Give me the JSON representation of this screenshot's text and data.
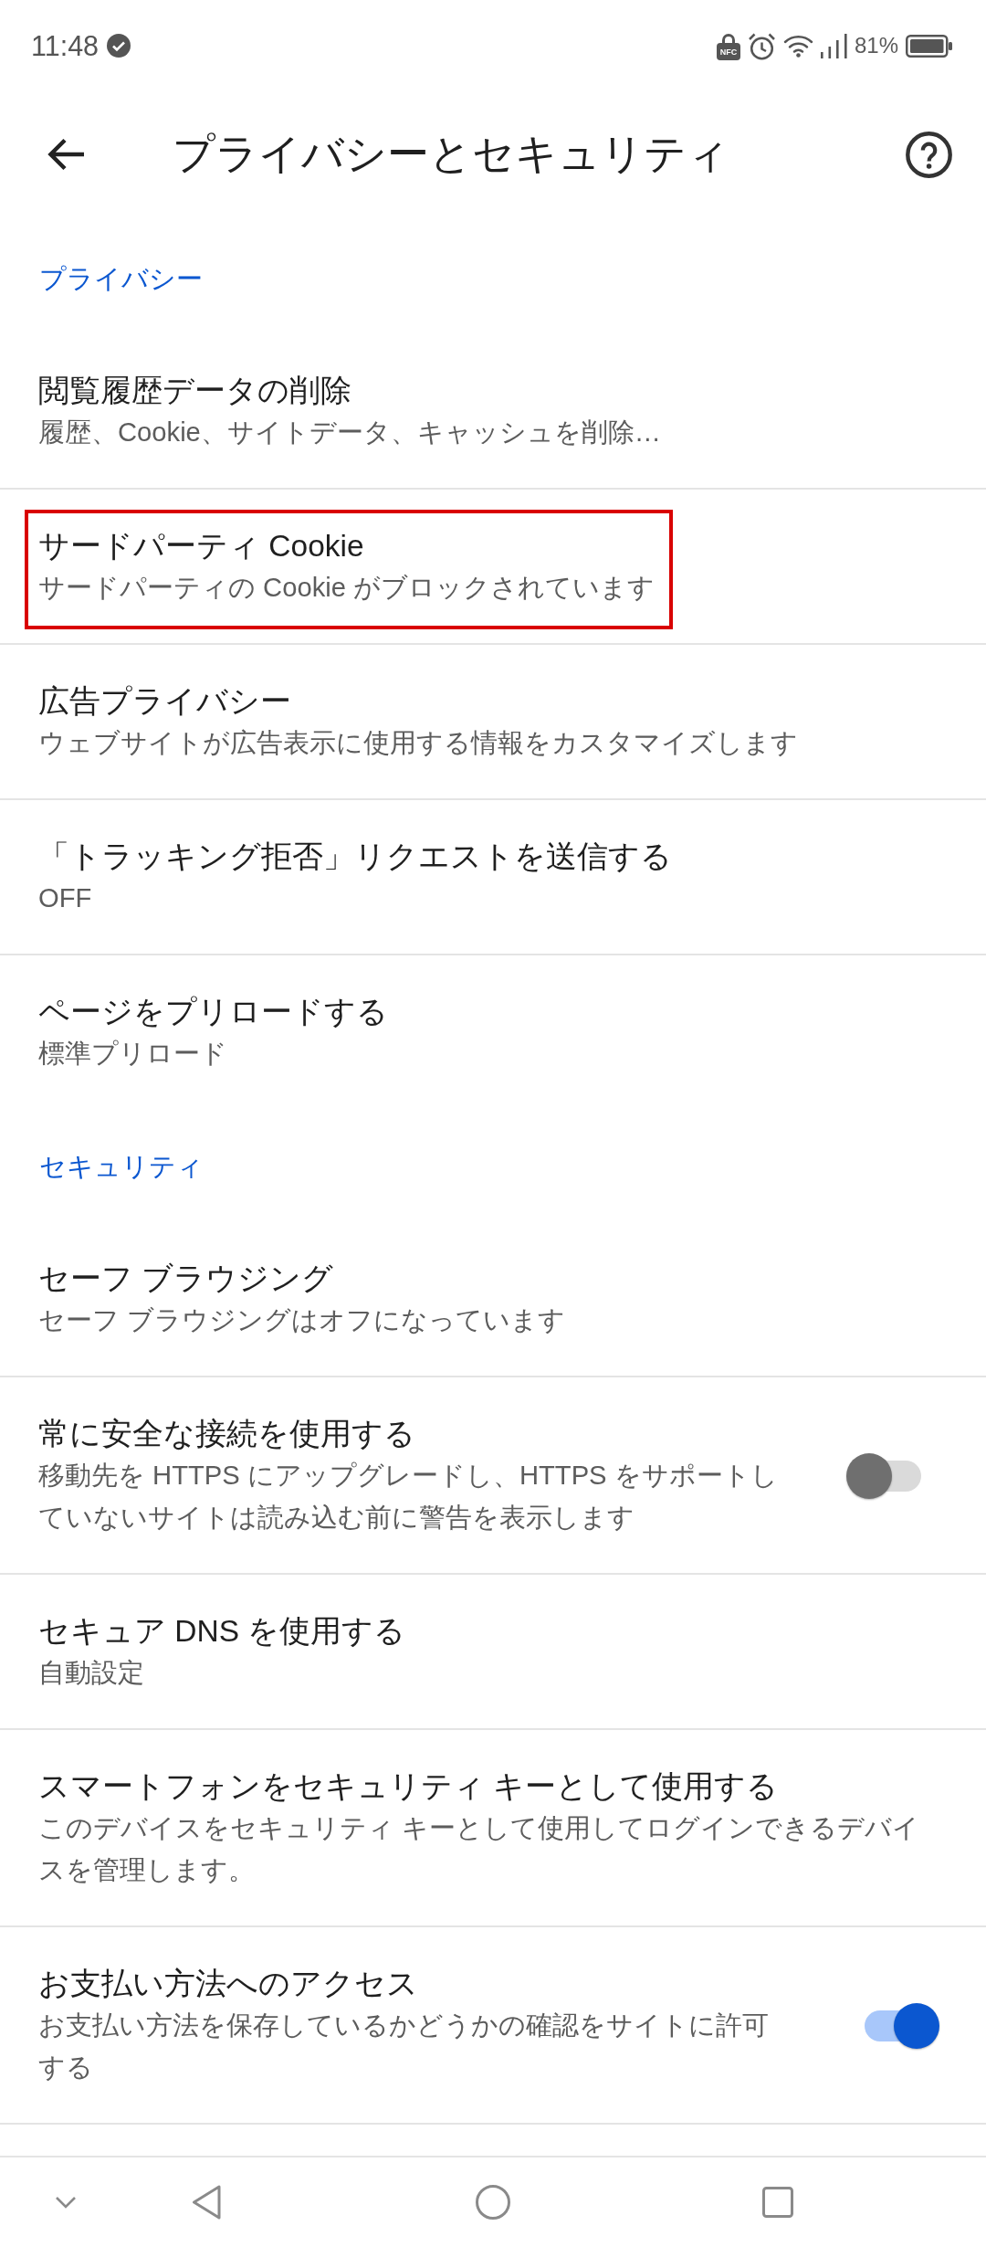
{
  "status_bar": {
    "time": "11:48",
    "nfc_label": "NFC",
    "battery_percent": "81%"
  },
  "app_bar": {
    "title": "プライバシーとセキュリティ"
  },
  "sections": [
    {
      "title": "プライバシー",
      "items": [
        {
          "kind": "link",
          "title": "閲覧履歴データの削除",
          "subtitle": "履歴、Cookie、サイトデータ、キャッシュを削除…",
          "highlighted": false
        },
        {
          "kind": "link",
          "title": "サードパーティ Cookie",
          "subtitle": "サードパーティの Cookie がブロックされています",
          "highlighted": true
        },
        {
          "kind": "link",
          "title": "広告プライバシー",
          "subtitle": "ウェブサイトが広告表示に使用する情報をカスタマイズします",
          "highlighted": false
        },
        {
          "kind": "link",
          "title": "「トラッキング拒否」リクエストを送信する",
          "subtitle": "OFF",
          "highlighted": false
        },
        {
          "kind": "link",
          "title": "ページをプリロードする",
          "subtitle": "標準プリロード",
          "highlighted": false
        }
      ]
    },
    {
      "title": "セキュリティ",
      "items": [
        {
          "kind": "link",
          "title": "セーフ ブラウジング",
          "subtitle": "セーフ ブラウジングはオフになっています",
          "highlighted": false
        },
        {
          "kind": "toggle",
          "title": "常に安全な接続を使用する",
          "subtitle": "移動先を HTTPS にアップグレードし、HTTPS をサポートしていないサイトは読み込む前に警告を表示します",
          "on": false,
          "highlighted": false
        },
        {
          "kind": "link",
          "title": "セキュア DNS を使用する",
          "subtitle": "自動設定",
          "highlighted": false
        },
        {
          "kind": "link",
          "title": "スマートフォンをセキュリティ キーとして使用する",
          "subtitle": "このデバイスをセキュリティ キーとして使用してログインできるデバイスを管理します。",
          "highlighted": false
        },
        {
          "kind": "toggle",
          "title": "お支払い方法へのアクセス",
          "subtitle": "お支払い方法を保存しているかどうかの確認をサイトに許可する",
          "on": true,
          "highlighted": false
        }
      ]
    }
  ]
}
